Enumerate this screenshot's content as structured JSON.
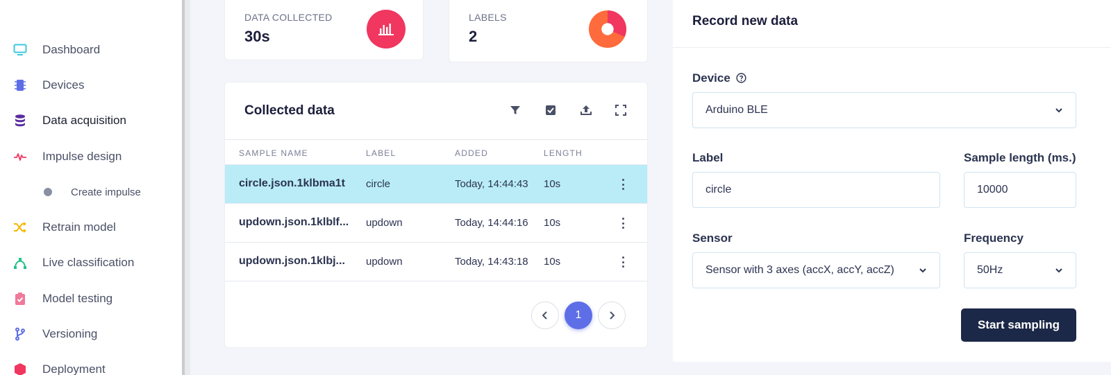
{
  "colors": {
    "accent": "#5e6ee6",
    "selected_row": "#b9ecf7",
    "primary_button": "#1c2847",
    "data_icon": "#f1365f",
    "labels_pie_main": "#ff6b3d",
    "labels_pie_slice": "#f1365f"
  },
  "sidebar": {
    "items": [
      {
        "label": "Dashboard",
        "icon": "monitor-icon",
        "color": "#3cc9dd"
      },
      {
        "label": "Devices",
        "icon": "chip-icon",
        "color": "#5e6ee6"
      },
      {
        "label": "Data acquisition",
        "icon": "database-icon",
        "color": "#5a2ca0",
        "active": true
      },
      {
        "label": "Impulse design",
        "icon": "pulse-icon",
        "color": "#f1365f"
      },
      {
        "label": "Create impulse",
        "icon": "dot-icon",
        "color": "#8a8fa3"
      },
      {
        "label": "Retrain model",
        "icon": "shuffle-icon",
        "color": "#f5b800"
      },
      {
        "label": "Live classification",
        "icon": "bezier-icon",
        "color": "#22c48a"
      },
      {
        "label": "Model testing",
        "icon": "clipboard-check-icon",
        "color": "#f07a9a"
      },
      {
        "label": "Versioning",
        "icon": "branch-icon",
        "color": "#5e6ee6"
      },
      {
        "label": "Deployment",
        "icon": "box-icon",
        "color": "#f1365f"
      }
    ]
  },
  "stats": {
    "data_collected": {
      "label": "DATA COLLECTED",
      "value": "30s",
      "icon": "bar-chart-icon"
    },
    "labels": {
      "label": "LABELS",
      "value": "2",
      "icon": "pie-chart-icon"
    }
  },
  "collected": {
    "title": "Collected data",
    "tools": [
      "filter-icon",
      "checkbox-icon",
      "upload-icon",
      "fullscreen-icon"
    ],
    "columns": [
      "SAMPLE NAME",
      "LABEL",
      "ADDED",
      "LENGTH"
    ],
    "rows": [
      {
        "name": "circle.json.1klbma1t",
        "label": "circle",
        "added": "Today, 14:44:43",
        "length": "10s",
        "selected": true
      },
      {
        "name": "updown.json.1klblf...",
        "label": "updown",
        "added": "Today, 14:44:16",
        "length": "10s"
      },
      {
        "name": "updown.json.1klbj...",
        "label": "updown",
        "added": "Today, 14:43:18",
        "length": "10s"
      }
    ],
    "pagination": {
      "current": "1"
    }
  },
  "record": {
    "title": "Record new data",
    "device_label": "Device",
    "device_value": "Arduino BLE",
    "label_label": "Label",
    "label_value": "circle",
    "sample_length_label": "Sample length (ms.)",
    "sample_length_value": "10000",
    "sensor_label": "Sensor",
    "sensor_value": "Sensor with 3 axes (accX, accY, accZ)",
    "frequency_label": "Frequency",
    "frequency_value": "50Hz",
    "start_button": "Start sampling"
  }
}
